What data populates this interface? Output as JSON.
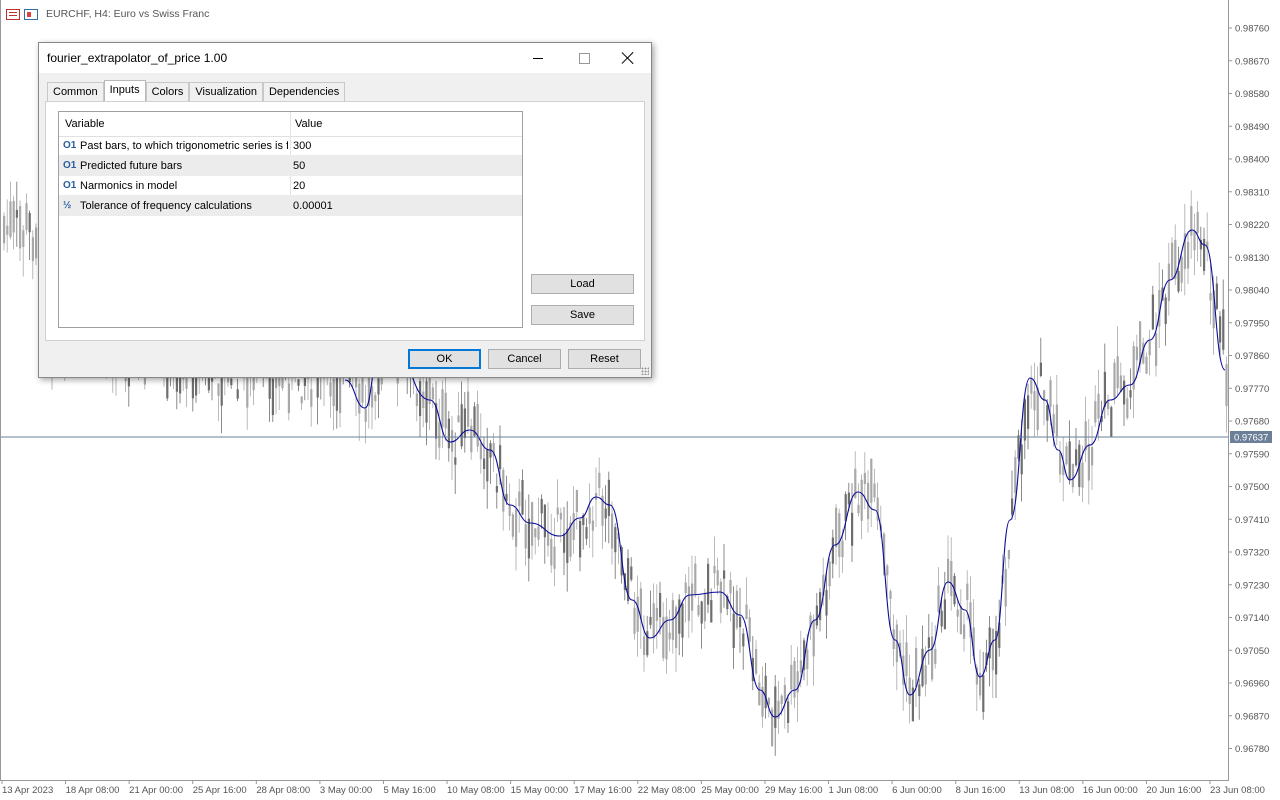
{
  "chart": {
    "symbol_label": "EURCHF, H4:  Euro vs Swiss Franc",
    "current_price": "0.97637",
    "price_axis": [
      "0.98760",
      "0.98670",
      "0.98580",
      "0.98490",
      "0.98400",
      "0.98310",
      "0.98220",
      "0.98130",
      "0.98040",
      "0.97950",
      "0.97860",
      "0.97770",
      "0.97680",
      "0.97590",
      "0.97500",
      "0.97410",
      "0.97320",
      "0.97230",
      "0.97140",
      "0.97050",
      "0.96960",
      "0.96870",
      "0.96780"
    ],
    "time_axis": [
      "13 Apr 2023",
      "18 Apr 08:00",
      "21 Apr 00:00",
      "25 Apr 16:00",
      "28 Apr 08:00",
      "3 May 00:00",
      "5 May 16:00",
      "10 May 08:00",
      "15 May 00:00",
      "17 May 16:00",
      "22 May 08:00",
      "25 May 00:00",
      "29 May 16:00",
      "1 Jun 08:00",
      "6 Jun 00:00",
      "8 Jun 16:00",
      "13 Jun 08:00",
      "16 Jun 00:00",
      "20 Jun 16:00",
      "23 Jun 08:00"
    ],
    "colors": {
      "candle": "#a8a8a8",
      "candle_dark": "#6e6e6e",
      "indicator": "#0b0b9a",
      "price_line": "#6b7f99",
      "axis": "#999999"
    }
  },
  "dialog": {
    "title": "fourier_extrapolator_of_price 1.00",
    "tabs": [
      "Common",
      "Inputs",
      "Colors",
      "Visualization",
      "Dependencies"
    ],
    "active_tab": "Inputs",
    "grid": {
      "headers": {
        "variable": "Variable",
        "value": "Value"
      },
      "rows": [
        {
          "icon": "O1",
          "name": "Past bars, to which trigonometric series is fitted",
          "value": "300"
        },
        {
          "icon": "O1",
          "name": "Predicted future bars",
          "value": "50"
        },
        {
          "icon": "O1",
          "name": "Narmonics in model",
          "value": "20"
        },
        {
          "icon": "½",
          "name": "Tolerance of frequency calculations",
          "value": "0.00001"
        }
      ]
    },
    "buttons": {
      "load": "Load",
      "save": "Save",
      "ok": "OK",
      "cancel": "Cancel",
      "reset": "Reset"
    }
  }
}
